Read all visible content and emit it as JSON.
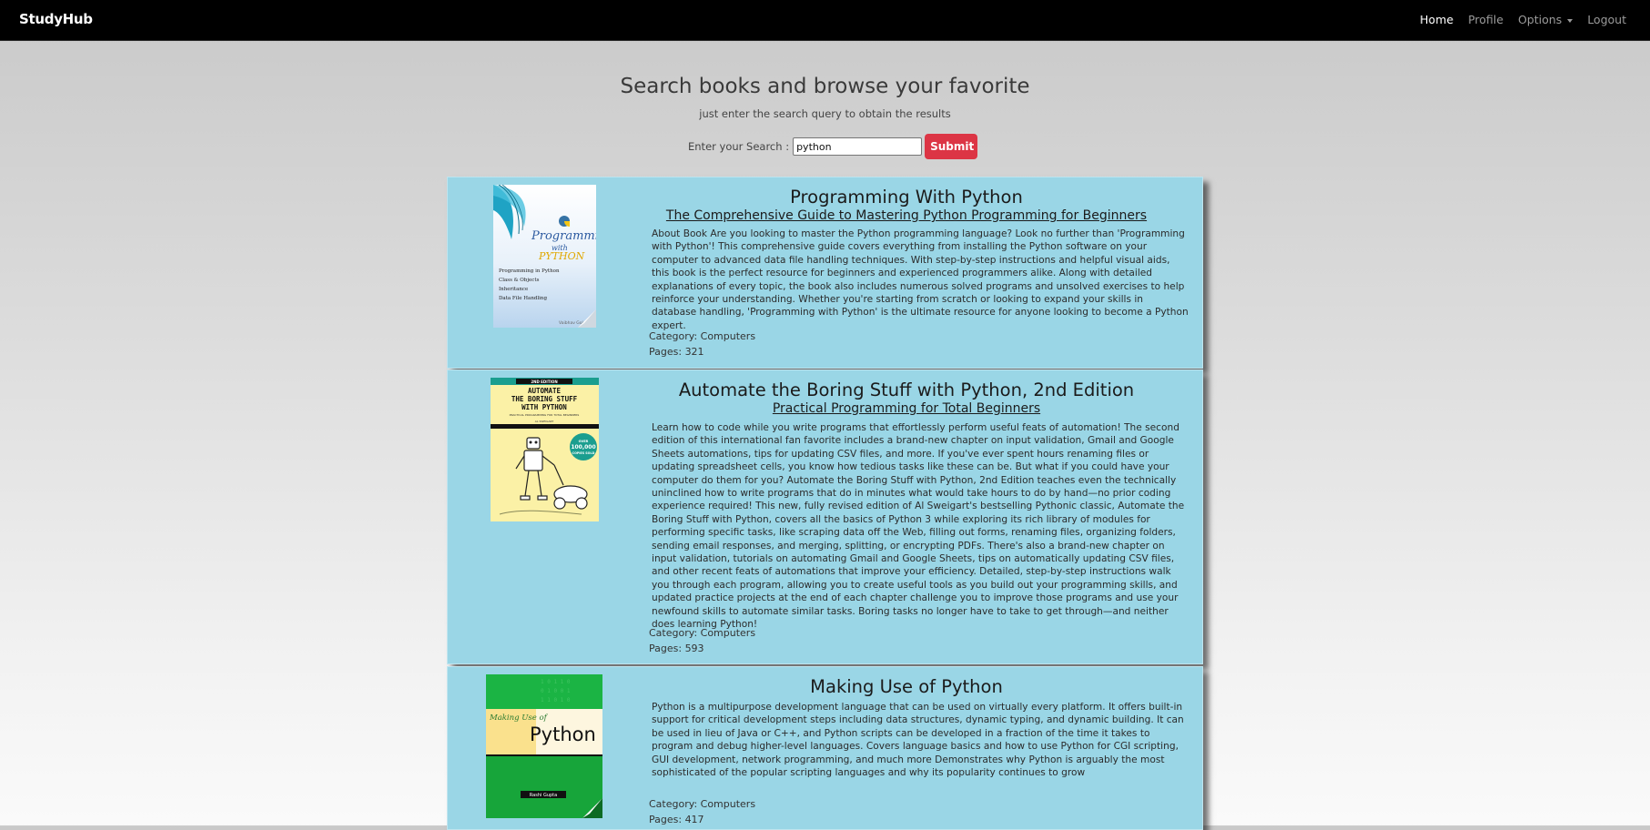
{
  "nav": {
    "brand": "StudyHub",
    "links": [
      {
        "label": "Home",
        "active": true
      },
      {
        "label": "Profile",
        "active": false
      },
      {
        "label": "Options",
        "active": false,
        "dropdown": true
      },
      {
        "label": "Logout",
        "active": false
      }
    ]
  },
  "search": {
    "title": "Search books and browse your favorite",
    "subtitle": "just enter the search query to obtain the results",
    "label": "Enter your Search :",
    "value": "python",
    "submit_label": "Submit"
  },
  "books": [
    {
      "title": "Programming With Python",
      "subtitle": "The Comprehensive Guide to Mastering Python Programming for Beginners",
      "description": "About Book Are you looking to master the Python programming language? Look no further than 'Programming with Python'! This comprehensive guide covers everything from installing the Python software on your computer to advanced data file handling techniques. With step-by-step instructions and helpful visual aids, this book is the perfect resource for beginners and experienced programmers alike. Along with detailed explanations of every topic, the book also includes numerous solved programs and unsolved exercises to help reinforce your understanding. Whether you're starting from scratch or looking to expand your skills in database handling, 'Programming with Python' is the ultimate resource for anyone looking to become a Python expert.",
      "category": "Category: Computers",
      "pages": "Pages: 321",
      "cover": {
        "title_line1": "Programming",
        "title_line2": "with",
        "title_line3": "PYTHON",
        "topics": [
          "Programming in Python",
          "Class & Objects",
          "Inheritance",
          "Data File Handling"
        ],
        "author": "Vaibhav Gole"
      }
    },
    {
      "title": "Automate the Boring Stuff with Python, 2nd Edition",
      "subtitle": "Practical Programming for Total Beginners",
      "description": "Learn how to code while you write programs that effortlessly perform useful feats of automation! The second edition of this international fan favorite includes a brand-new chapter on input validation, Gmail and Google Sheets automations, tips for updating CSV files, and more. If you've ever spent hours renaming files or updating spreadsheet cells, you know how tedious tasks like these can be. But what if you could have your computer do them for you? Automate the Boring Stuff with Python, 2nd Edition teaches even the technically uninclined how to write programs that do in minutes what would take hours to do by hand—no prior coding experience required! This new, fully revised edition of Al Sweigart's bestselling Pythonic classic, Automate the Boring Stuff with Python, covers all the basics of Python 3 while exploring its rich library of modules for performing specific tasks, like scraping data off the Web, filling out forms, renaming files, organizing folders, sending email responses, and merging, splitting, or encrypting PDFs. There's also a brand-new chapter on input validation, tutorials on automating Gmail and Google Sheets, tips on automatically updating CSV files, and other recent feats of automations that improve your efficiency. Detailed, step-by-step instructions walk you through each program, allowing you to create useful tools as you build out your programming skills, and updated practice projects at the end of each chapter challenge you to improve those programs and use your newfound skills to automate similar tasks. Boring tasks no longer have to take to get through—and neither does learning Python!",
      "category": "Category: Computers",
      "pages": "Pages: 593",
      "cover": {
        "edition": "2ND EDITION",
        "title_line1": "AUTOMATE",
        "title_line2": "THE BORING STUFF",
        "title_line3": "WITH PYTHON",
        "tagline": "PRACTICAL PROGRAMMING FOR TOTAL BEGINNERS",
        "author": "AL SWEIGART",
        "badge_line1": "OVER",
        "badge_line2": "100,000",
        "badge_line3": "COPIES SOLD"
      }
    },
    {
      "title": "Making Use of Python",
      "description": "Python is a multipurpose development language that can be used on virtually every platform. It offers built-in support for critical development steps including data structures, dynamic typing, and dynamic building. It can be used in lieu of Java or C++, and Python scripts can be developed in a fraction of the time it takes to program and debug higher-level languages. Covers language basics and how to use Python for CGI scripting, GUI development, network programming, and much more Demonstrates why Python is arguably the most sophisticated of the popular scripting languages and why its popularity continues to grow",
      "category": "Category: Computers",
      "pages": "Pages: 417",
      "cover": {
        "title_line1": "Making Use of",
        "title_line2": "Python",
        "author": "Rashi Gupta"
      }
    }
  ],
  "colors": {
    "navbar": "#000000",
    "card_bg": "#9ad6e6",
    "submit": "#dc3545"
  }
}
